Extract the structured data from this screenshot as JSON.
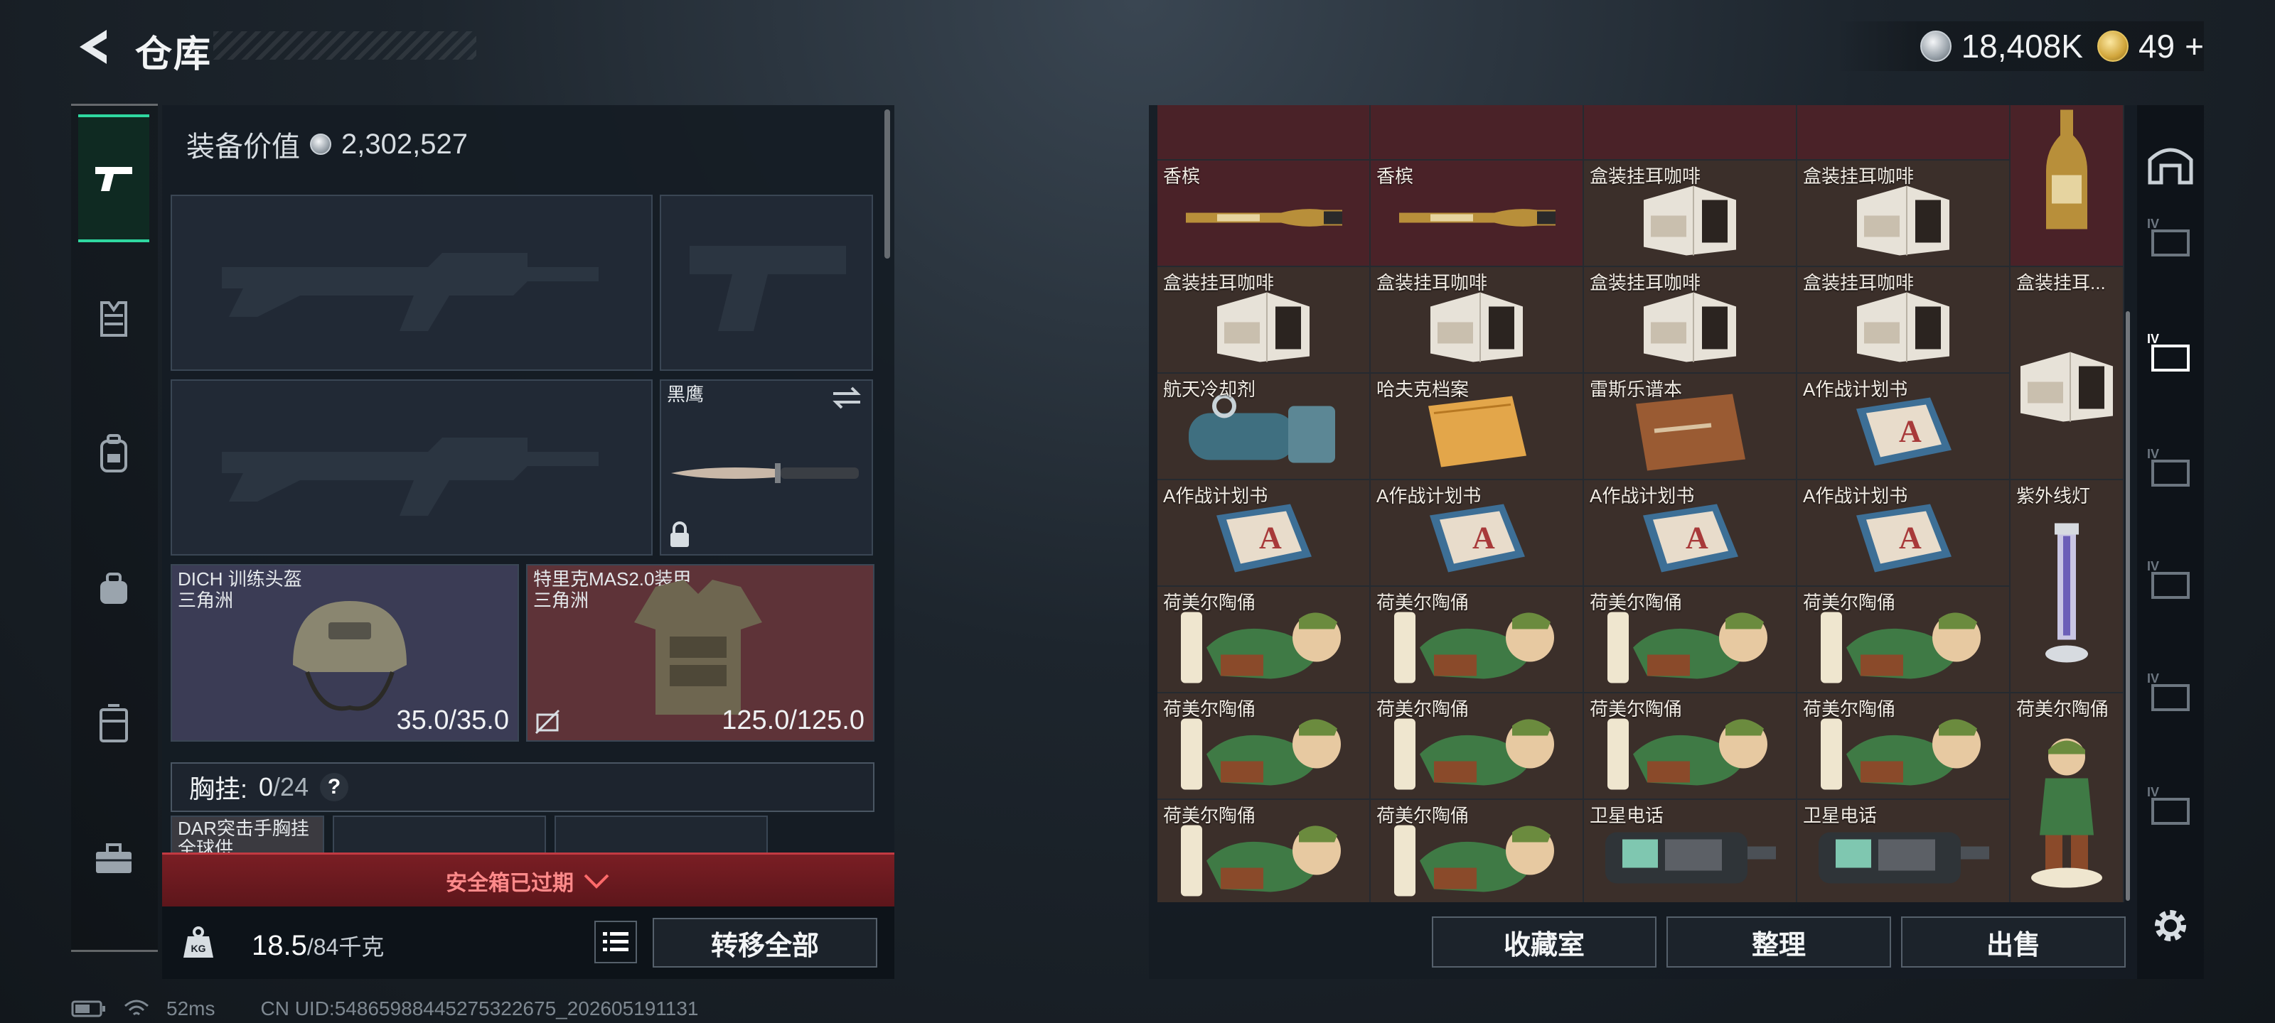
{
  "header": {
    "title": "仓库",
    "silver_amount": "18,408K",
    "gold_amount": "49",
    "gold_plus": "+"
  },
  "loadout": {
    "equip_value_label": "装备价值",
    "equip_value": "2,302,527",
    "knife_name": "黑鹰",
    "helmet_name": "DICH 训练头盔",
    "helmet_tag": "三角洲",
    "helmet_durability": "35.0/35.0",
    "armor_name": "特里克MAS2.0装甲",
    "armor_tag": "三角洲",
    "armor_durability": "125.0/125.0",
    "chest_label": "胸挂:",
    "chest_used": "0",
    "chest_total": "/24",
    "chest_help": "?",
    "chest_item_name": "DAR突击手胸挂",
    "chest_item_tag": "全球供",
    "safe_box_text": "安全箱已过期",
    "weight_current": "18.5",
    "weight_max": "/84千克",
    "kg_label": "KG",
    "transfer_all": "转移全部"
  },
  "storage": {
    "items": [
      {
        "label": "香槟",
        "kind": "champagne"
      },
      {
        "label": "香槟",
        "kind": "champagne"
      },
      {
        "label": "盒装挂耳咖啡",
        "kind": "coffee"
      },
      {
        "label": "盒装挂耳咖啡",
        "kind": "coffee"
      },
      {
        "label": "盒装挂耳咖啡",
        "kind": "coffee"
      },
      {
        "label": "盒装挂耳咖啡",
        "kind": "coffee"
      },
      {
        "label": "盒装挂耳咖啡",
        "kind": "coffee"
      },
      {
        "label": "盒装挂耳咖啡",
        "kind": "coffee"
      },
      {
        "label": "航天冷却剂",
        "kind": "coolant"
      },
      {
        "label": "哈夫克档案",
        "kind": "archive"
      },
      {
        "label": "雷斯乐谱本",
        "kind": "notebook"
      },
      {
        "label": "A作战计划书",
        "kind": "plan"
      },
      {
        "label": "A作战计划书",
        "kind": "plan"
      },
      {
        "label": "A作战计划书",
        "kind": "plan"
      },
      {
        "label": "A作战计划书",
        "kind": "plan"
      },
      {
        "label": "A作战计划书",
        "kind": "plan"
      },
      {
        "label": "荷美尔陶俑",
        "kind": "figurine"
      },
      {
        "label": "荷美尔陶俑",
        "kind": "figurine"
      },
      {
        "label": "荷美尔陶俑",
        "kind": "figurine"
      },
      {
        "label": "荷美尔陶俑",
        "kind": "figurine"
      },
      {
        "label": "荷美尔陶俑",
        "kind": "figurine"
      },
      {
        "label": "荷美尔陶俑",
        "kind": "figurine"
      },
      {
        "label": "荷美尔陶俑",
        "kind": "figurine"
      },
      {
        "label": "荷美尔陶俑",
        "kind": "figurine"
      },
      {
        "label": "荷美尔陶俑",
        "kind": "figurine"
      },
      {
        "label": "荷美尔陶俑",
        "kind": "figurine"
      },
      {
        "label": "卫星电话",
        "kind": "phone"
      },
      {
        "label": "卫星电话",
        "kind": "phone"
      }
    ],
    "tall_items": [
      {
        "label": "",
        "kind": "bottle"
      },
      {
        "label": "盒装挂耳...",
        "kind": "coffee"
      },
      {
        "label": "紫外线灯",
        "kind": "uvlamp"
      },
      {
        "label": "荷美尔陶俑",
        "kind": "figurine_tall"
      }
    ],
    "buttons": {
      "collection": "收藏室",
      "organize": "整理",
      "sell": "出售"
    }
  },
  "status": {
    "ping": "52ms",
    "uid": "CN UID:5486598844527532267​5_202605191131"
  },
  "colors": {
    "accent": "#2fd8a0",
    "warning_red": "#c23a42",
    "cell_brown": "#3b2f2a",
    "cell_red": "#4a2228"
  }
}
